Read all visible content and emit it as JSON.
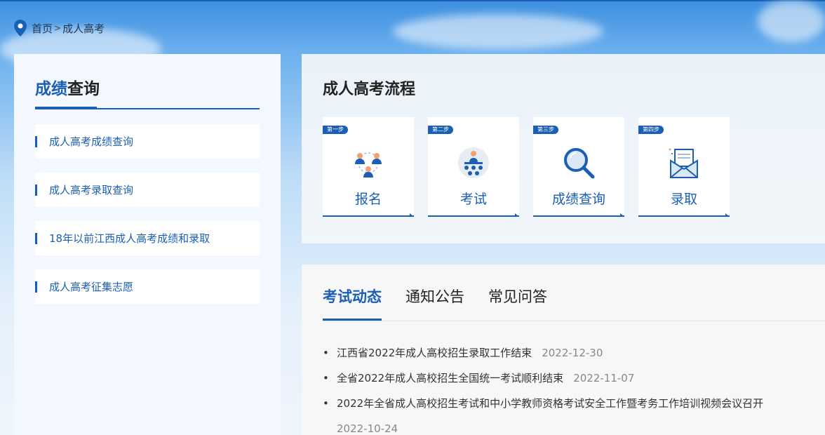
{
  "breadcrumb": {
    "home": "首页",
    "separator": ">",
    "current": "成人高考"
  },
  "sidebar": {
    "title_highlight": "成绩",
    "title_rest": "查询",
    "items": [
      {
        "label": "成人高考成绩查询"
      },
      {
        "label": "成人高考录取查询"
      },
      {
        "label": "18年以前江西成人高考成绩和录取"
      },
      {
        "label": "成人高考征集志愿"
      }
    ]
  },
  "process": {
    "title": "成人高考流程",
    "steps": [
      {
        "badge": "第一步",
        "label": "报名",
        "icon": "people-network-icon"
      },
      {
        "badge": "第二步",
        "label": "考试",
        "icon": "exam-hall-icon"
      },
      {
        "badge": "第三步",
        "label": "成绩查询",
        "icon": "magnifier-icon"
      },
      {
        "badge": "第四步",
        "label": "录取",
        "icon": "envelope-letter-icon"
      }
    ]
  },
  "news": {
    "tabs": [
      "考试动态",
      "通知公告",
      "常见问答"
    ],
    "active_tab": 0,
    "items": [
      {
        "title": "江西省2022年成人高校招生录取工作结束",
        "date": "2022-12-30"
      },
      {
        "title": "全省2022年成人高校招生全国统一考试顺利结束",
        "date": "2022-11-07"
      },
      {
        "title": "2022年全省成人高校招生考试和中小学教师资格考试安全工作暨考务工作培训视频会议召开",
        "date": "2022-10-24"
      }
    ]
  },
  "colors": {
    "brand": "#1a5fb4",
    "text": "#333333",
    "date": "#888888"
  }
}
